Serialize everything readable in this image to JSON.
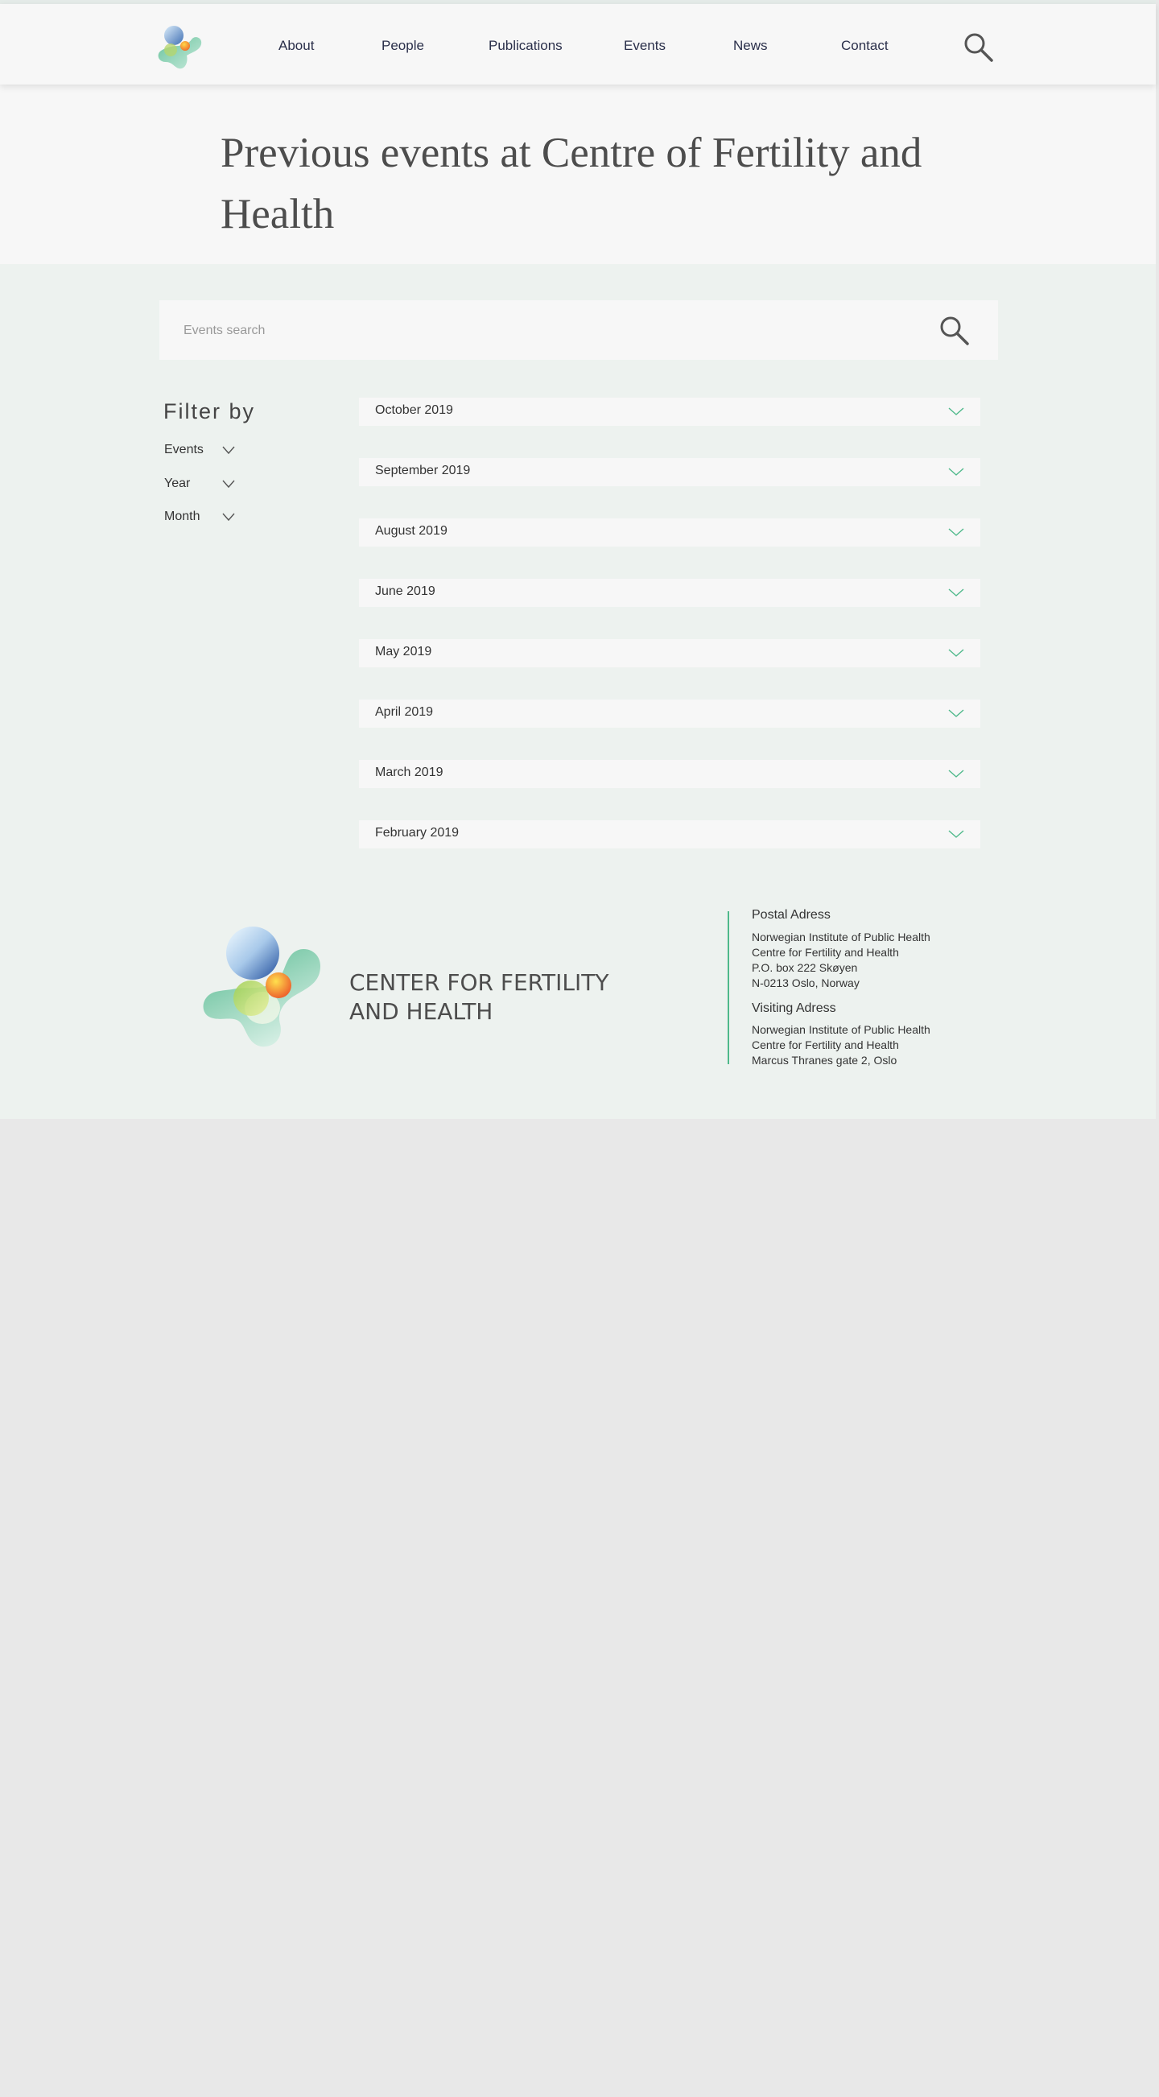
{
  "nav": {
    "items": [
      {
        "label": "About"
      },
      {
        "label": "People"
      },
      {
        "label": "Publications"
      },
      {
        "label": "Events"
      },
      {
        "label": "News"
      },
      {
        "label": "Contact"
      }
    ]
  },
  "page": {
    "title": "Previous events at Centre of Fertility and Health"
  },
  "search": {
    "placeholder": "Events search",
    "value": ""
  },
  "filter": {
    "title": "Filter by",
    "items": [
      {
        "label": "Events"
      },
      {
        "label": "Year"
      },
      {
        "label": "Month"
      }
    ]
  },
  "months": [
    {
      "label": "October 2019"
    },
    {
      "label": "September 2019"
    },
    {
      "label": "August 2019"
    },
    {
      "label": "June 2019"
    },
    {
      "label": "May 2019"
    },
    {
      "label": "April 2019"
    },
    {
      "label": "March 2019"
    },
    {
      "label": "February 2019"
    }
  ],
  "footer": {
    "org_line1": "CENTER FOR FERTILITY",
    "org_line2": "AND HEALTH",
    "postal": {
      "heading": "Postal Adress",
      "lines": [
        "Norwegian Institute of Public Health",
        "Centre for Fertility and Health",
        "P.O. box 222 Skøyen",
        "N-0213 Oslo, Norway"
      ]
    },
    "visiting": {
      "heading": "Visiting Adress",
      "lines": [
        "Norwegian Institute of Public Health",
        "Centre for Fertility and Health",
        "Marcus Thranes gate 2, Oslo"
      ]
    }
  },
  "colors": {
    "accent_green": "#4fb98b",
    "page_background": "#edf2ef",
    "panel_background": "#f7f7f7",
    "nav_text": "#2a2f4a"
  },
  "icons": [
    "logo-mark",
    "search-icon",
    "chevron-down-icon"
  ]
}
